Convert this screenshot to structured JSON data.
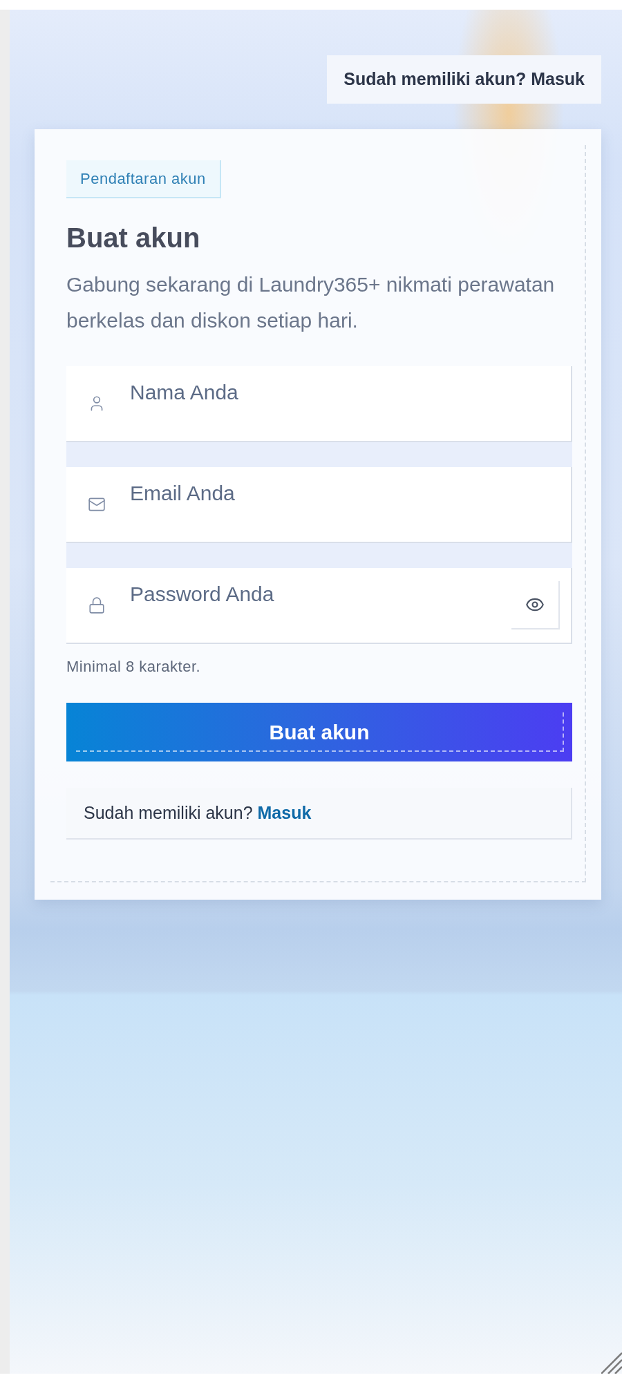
{
  "header": {
    "signin_button": "Sudah memiliki akun? Masuk"
  },
  "card": {
    "badge": "Pendaftaran akun",
    "title": "Buat akun",
    "description": "Gabung sekarang di Laundry365+ nikmati perawatan berkelas dan diskon setiap hari."
  },
  "form": {
    "fields": [
      {
        "kind": "name",
        "placeholder": "Nama Anda"
      },
      {
        "kind": "email",
        "placeholder": "Email Anda"
      },
      {
        "kind": "password",
        "placeholder": "Password Anda"
      }
    ],
    "hint": "Minimal 8 karakter.",
    "submit": "Buat akun"
  },
  "footer": {
    "prompt": "Sudah memiliki akun?",
    "link": "Masuk"
  }
}
